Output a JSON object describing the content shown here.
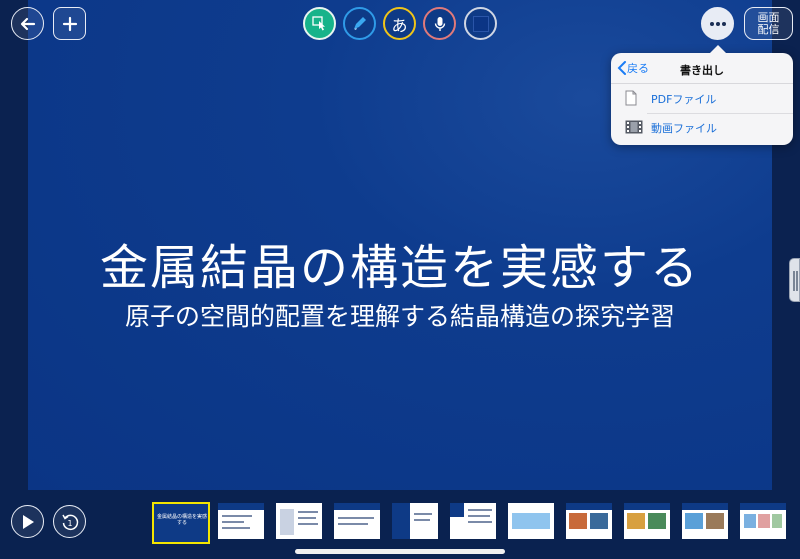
{
  "toolbar": {
    "back_icon": "arrow-left-icon",
    "add_icon": "plus-icon",
    "tools": [
      {
        "name": "pointer-tool",
        "icon": "hand-pointer-icon",
        "color": "#17b38a"
      },
      {
        "name": "pen-tool",
        "icon": "marker-icon",
        "color": "#2f9be8"
      },
      {
        "name": "text-tool",
        "label": "あ",
        "color": "#f0c419"
      },
      {
        "name": "voice-tool",
        "icon": "microphone-icon",
        "color": "#e07a7a"
      },
      {
        "name": "color-tool",
        "icon": "square-swatch-icon",
        "color": "#0e3a86"
      }
    ],
    "more_icon": "ellipsis-icon",
    "broadcast_label": "画面\n配信"
  },
  "export_menu": {
    "back_label": "戻る",
    "title": "書き出し",
    "items": [
      {
        "label": "PDFファイル",
        "icon": "document-icon"
      },
      {
        "label": "動画ファイル",
        "icon": "film-icon"
      }
    ]
  },
  "slide": {
    "title": "金属結晶の構造を実感する",
    "subtitle": "原子の空間的配置を理解する結晶構造の探究学習"
  },
  "playback": {
    "play_icon": "play-icon",
    "replay_icon": "replay-one-icon"
  },
  "thumbnails": {
    "active_index": 0,
    "count": 11,
    "active_caption": "金属結晶の構造を実感する"
  }
}
